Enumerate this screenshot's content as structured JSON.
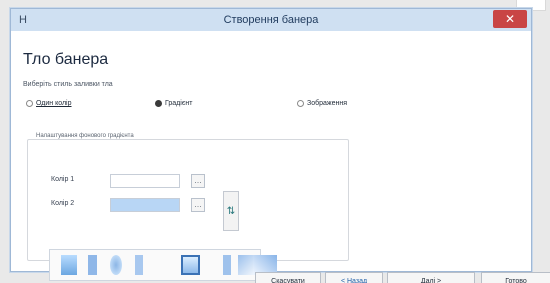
{
  "window": {
    "title": "Створення банера",
    "app_icon": "Н"
  },
  "page": {
    "heading": "Тло банера",
    "instruction": "Виберіть стиль заливки тла"
  },
  "fill_style": {
    "options": [
      "Один колір",
      "Градієнт",
      "Зображення"
    ],
    "selected": "Градієнт"
  },
  "gradient_group": {
    "legend": "Налаштування фонового градієнта",
    "color1_label": "Колір 1",
    "color2_label": "Колір 2",
    "color1_value": "#ffffff",
    "color2_value": "#b8d6f5"
  },
  "buttons": {
    "cancel": "Скасувати",
    "back": "< Назад",
    "next": "Далі >",
    "done": "Готово"
  }
}
